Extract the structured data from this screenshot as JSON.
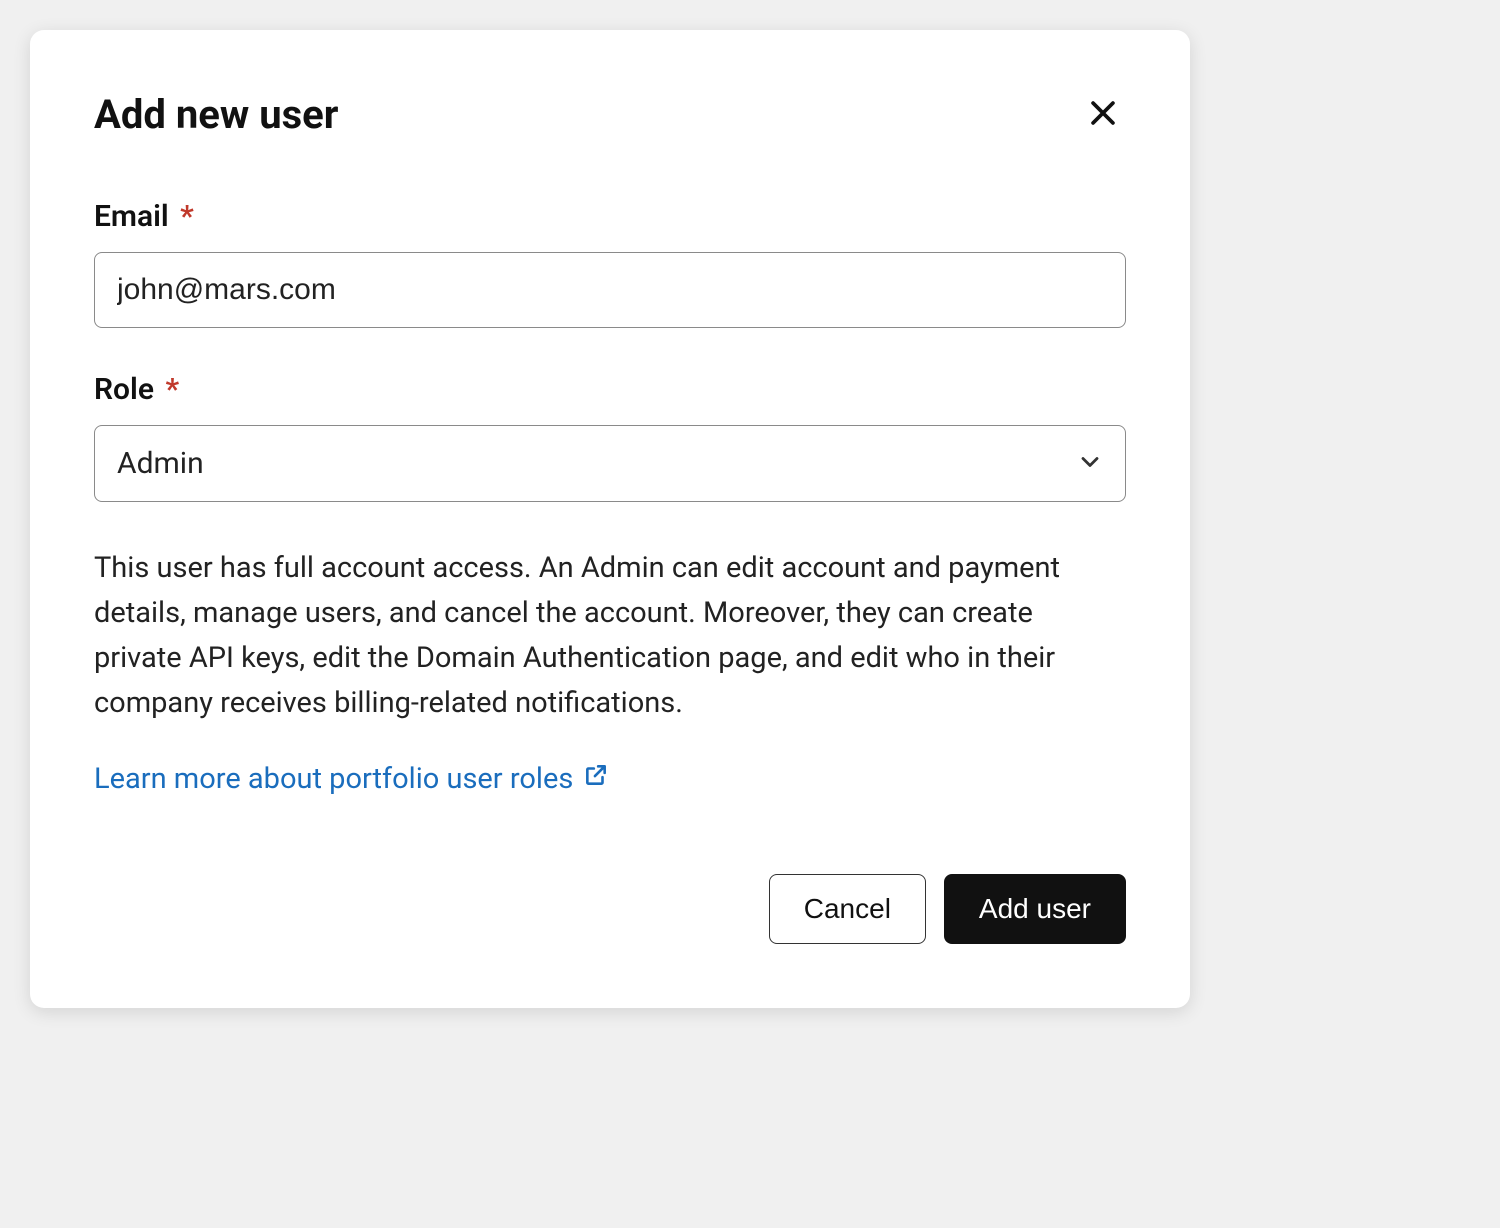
{
  "modal": {
    "title": "Add new user",
    "fields": {
      "email": {
        "label": "Email",
        "required_symbol": "*",
        "value": "john@mars.com"
      },
      "role": {
        "label": "Role",
        "required_symbol": "*",
        "selected": "Admin"
      }
    },
    "description": "This user has full account access. An Admin can edit account and payment details, manage users, and cancel the account. Moreover, they can create private API keys, edit the Domain Authentication page, and edit who in their company receives billing-related notifications.",
    "learn_more": "Learn more about portfolio user roles",
    "footer": {
      "cancel": "Cancel",
      "submit": "Add user"
    }
  }
}
